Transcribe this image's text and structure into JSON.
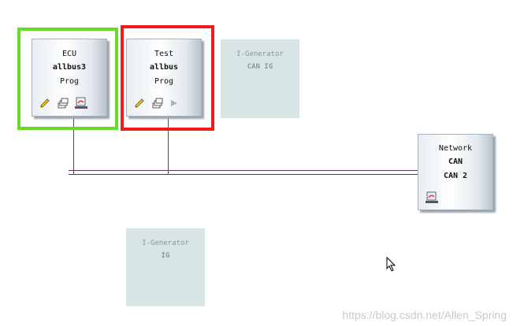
{
  "ecu_node": {
    "line1": "ECU",
    "line2": "allbus3",
    "line3": "Prog",
    "selection_color": "#66dd22"
  },
  "test_node": {
    "line1": "Test",
    "line2": "allbus",
    "line3": "Prog",
    "selection_color": "#ee1c1c"
  },
  "network_node": {
    "line1": "Network",
    "line2": "CAN",
    "line3": "CAN 2"
  },
  "igen_top": {
    "line1": "I-Generator",
    "line2": "CAN IG"
  },
  "igen_bottom": {
    "line1": "I-Generator",
    "line2": "IG"
  },
  "icons": [
    "edit-pencil-icon",
    "stack-pages-icon",
    "database-icon",
    "play-icon"
  ],
  "watermark": "https://blog.csdn.net/Allen_Spring",
  "colors": {
    "bus_line": "#7a2f7a",
    "ig_bg": "#d8e5e5"
  }
}
